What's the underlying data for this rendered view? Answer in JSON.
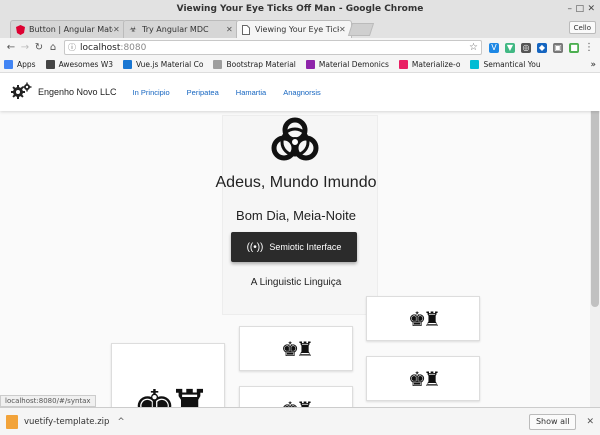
{
  "window": {
    "title": "Viewing Your Eye Ticks Off Man - Google Chrome"
  },
  "tabs": [
    {
      "label": "Button | Angular Mate",
      "icon": "angular-icon"
    },
    {
      "label": "Try Angular MDC",
      "icon": "biohazard-icon"
    },
    {
      "label": "Viewing Your Eye Ticks",
      "icon": "page-icon",
      "active": true
    }
  ],
  "user_badge": "Cello",
  "address": {
    "host": "localhost",
    "port": ":8080"
  },
  "bookmarks": [
    {
      "label": "Apps",
      "color": "#4285f4"
    },
    {
      "label": "Awesomes W3",
      "color": "#444444"
    },
    {
      "label": "Vue.js Material Co",
      "color": "#1976d2"
    },
    {
      "label": "Bootstrap Material",
      "color": "#9e9e9e"
    },
    {
      "label": "Material Demonics",
      "color": "#8e24aa"
    },
    {
      "label": "Materialize-o",
      "color": "#e91e63"
    },
    {
      "label": "Semantical You",
      "color": "#00bcd4"
    }
  ],
  "app": {
    "brand": "Engenho Novo LLC",
    "nav": [
      "In Principio",
      "Peripatea",
      "Hamartia",
      "Anagnorsis"
    ],
    "hero_title": "Adeus, Mundo Imundo",
    "hero_subtitle": "Bom Dia, Meia-Noite",
    "button_label": "Semiotic Interface",
    "footer_text": "A Linguistic Linguiça"
  },
  "status_url": "localhost:8080/#/syntax",
  "downloads": {
    "filename": "vuetify-template.zip",
    "show_all": "Show all"
  },
  "colors": {
    "nav_link": "#1565c0",
    "button_bg": "#2b2b2b"
  }
}
